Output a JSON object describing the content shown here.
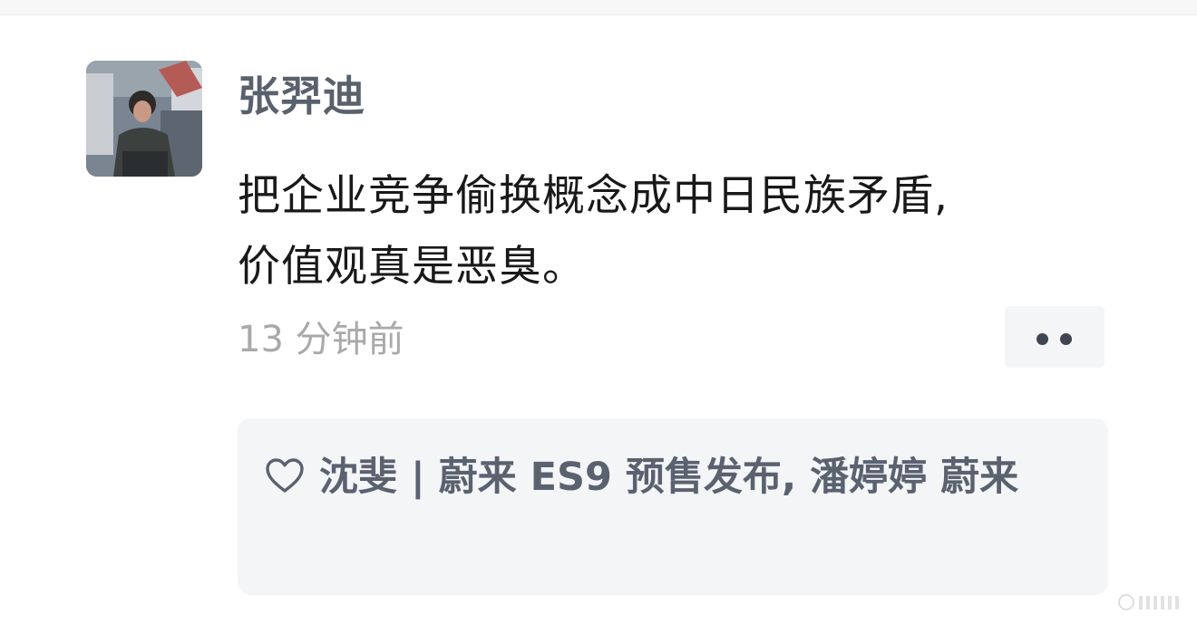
{
  "post": {
    "author": "张羿迪",
    "comment_line1": "把企业竞争偷换概念成中日民族矛盾,",
    "comment_line2": "价值观真是恶臭。",
    "timestamp": "13 分钟前"
  },
  "quote": {
    "icon": "heart-outline-icon",
    "text": "沈斐 | 蔚来 ES9 预售发布, 潘婷婷 蔚来"
  },
  "colors": {
    "author": "#59616d",
    "comment": "#191919",
    "timestamp": "#a9a9a9",
    "card_bg": "#f4f5f7",
    "quote_text": "#5a6270"
  }
}
